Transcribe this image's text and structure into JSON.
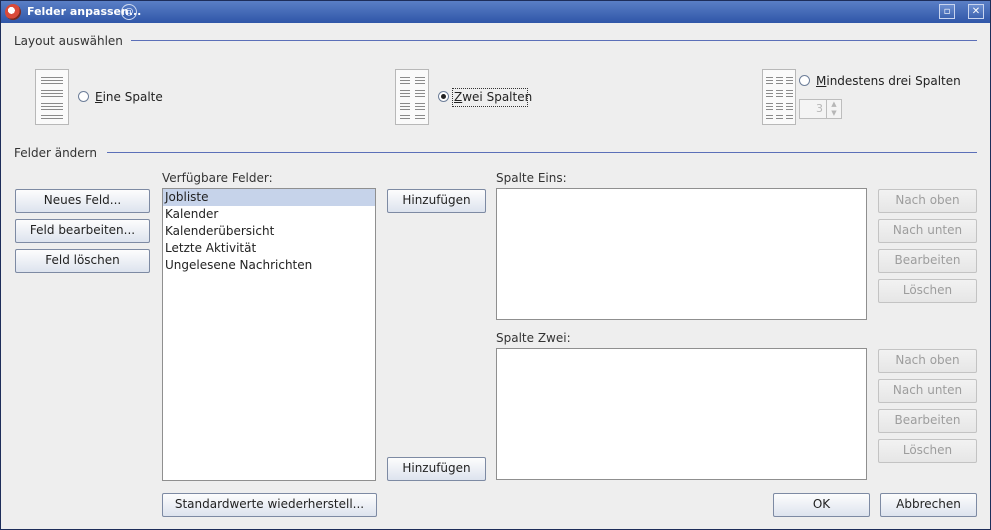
{
  "window": {
    "title": "Felder anpassen..."
  },
  "layout_section": {
    "title": "Layout auswählen",
    "options": [
      {
        "mnemonic": "E",
        "rest": "ine Spalte",
        "checked": false
      },
      {
        "mnemonic": "Z",
        "rest": "wei Spalten",
        "checked": true
      },
      {
        "mnemonic": "M",
        "rest": "indestens drei Spalten",
        "checked": false
      }
    ],
    "columns_spinner_value": "3"
  },
  "fields_section": {
    "title": "Felder ändern",
    "new_field_button": "Neues Feld...",
    "edit_field_button": "Feld bearbeiten...",
    "delete_field_button": "Feld löschen",
    "available_label": "Verfügbare Felder:",
    "available_fields": [
      "Jobliste",
      "Kalender",
      "Kalenderübersicht",
      "Letzte Aktivität",
      "Ungelesene Nachrichten"
    ],
    "selected_index": 0,
    "add_button": "Hinzufügen",
    "column_one_label": "Spalte Eins:",
    "column_two_label": "Spalte Zwei:",
    "move_up": "Nach oben",
    "move_down": "Nach unten",
    "edit": "Bearbeiten",
    "delete": "Löschen",
    "restore_defaults": "Standardwerte wiederherstell...",
    "ok": "OK",
    "cancel": "Abbrechen"
  }
}
